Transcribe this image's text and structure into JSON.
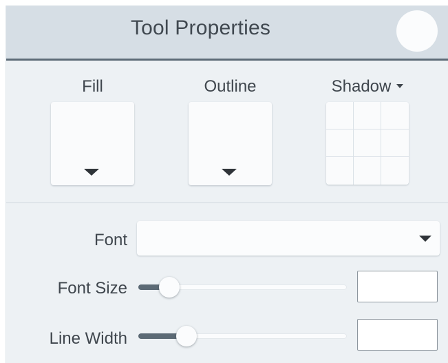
{
  "header": {
    "title": "Tool Properties"
  },
  "styles": {
    "fill_label": "Fill",
    "outline_label": "Outline",
    "shadow_label": "Shadow",
    "fill_color": "#fafbfc",
    "outline_color": "#fafbfc"
  },
  "text": {
    "font_label": "Font",
    "font_value": "",
    "font_size_label": "Font Size",
    "font_size_value": "",
    "font_size_level": 0.15,
    "line_width_label": "Line Width",
    "line_width_value": "",
    "line_width_level": 0.23
  },
  "colors": {
    "header_bg": "#d6dee5",
    "panel_bg": "#edf1f4",
    "accent": "#5c6a75"
  }
}
